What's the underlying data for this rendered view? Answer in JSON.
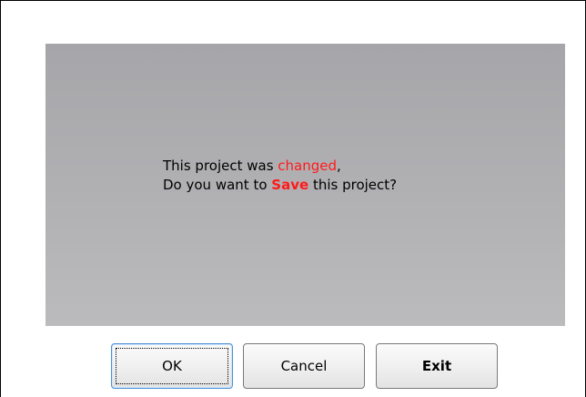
{
  "dialog": {
    "message": {
      "line1_prefix": "This project was ",
      "line1_highlight": "changed",
      "line1_suffix": ",",
      "line2_prefix": "Do you want to ",
      "line2_highlight": "Save",
      "line2_suffix": " this project?"
    },
    "buttons": {
      "ok_label": "OK",
      "cancel_label": "Cancel",
      "exit_label": "Exit"
    }
  },
  "colors": {
    "highlight": "#ff1a1a",
    "panel_top": "#a6a6aa",
    "panel_bottom": "#bbbbbd",
    "focus_border": "#4a8fd1"
  }
}
